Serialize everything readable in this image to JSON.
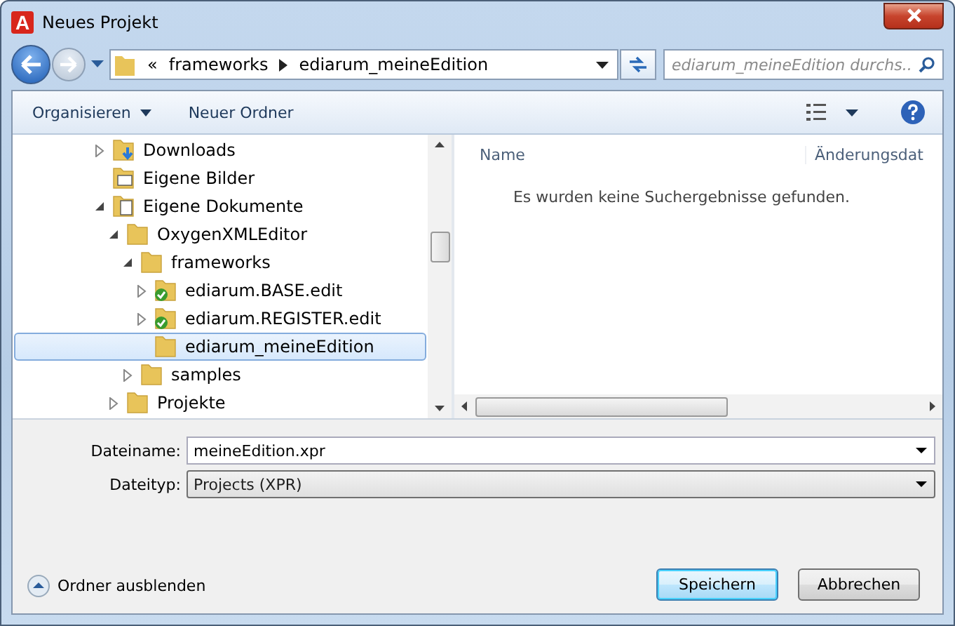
{
  "window": {
    "title": "Neues Projekt",
    "logo": "A"
  },
  "address": {
    "overflow": "«",
    "crumbs": [
      "frameworks",
      "ediarum_meineEdition"
    ]
  },
  "search": {
    "placeholder": "ediarum_meineEdition durchs..."
  },
  "toolbar": {
    "organize": "Organisieren",
    "new_folder": "Neuer Ordner"
  },
  "tree": [
    {
      "label": "Downloads",
      "kind": "download",
      "expanded": false,
      "selected": false
    },
    {
      "label": "Eigene Bilder",
      "kind": "pictures",
      "selected": false
    },
    {
      "label": "Eigene Dokumente",
      "kind": "documents",
      "expanded": true,
      "selected": false,
      "children": [
        {
          "label": "OxygenXMLEditor",
          "kind": "folder",
          "expanded": true,
          "selected": false,
          "children": [
            {
              "label": "frameworks",
              "kind": "folder",
              "expanded": true,
              "selected": false,
              "children": [
                {
                  "label": "ediarum.BASE.edit",
                  "kind": "folder-ok",
                  "expanded": false,
                  "selected": false
                },
                {
                  "label": "ediarum.REGISTER.edit",
                  "kind": "folder-ok",
                  "expanded": false,
                  "selected": false
                },
                {
                  "label": "ediarum_meineEdition",
                  "kind": "folder",
                  "selected": true
                }
              ]
            },
            {
              "label": "samples",
              "kind": "folder",
              "expanded": false,
              "selected": false
            }
          ]
        },
        {
          "label": "Projekte",
          "kind": "folder",
          "expanded": false,
          "selected": false
        }
      ]
    }
  ],
  "list": {
    "columns": [
      "Name",
      "Änderungsdat"
    ],
    "empty_message": "Es wurden keine Suchergebnisse gefunden."
  },
  "form": {
    "filename_label": "Dateiname:",
    "filename": "meineEdition.xpr",
    "filetype_label": "Dateityp:",
    "filetype": "Projects (XPR)"
  },
  "footer": {
    "hide_folders": "Ordner ausblenden",
    "buttons": [
      {
        "label": "Speichern",
        "default": true
      },
      {
        "label": "Abbrechen",
        "default": false
      }
    ]
  }
}
